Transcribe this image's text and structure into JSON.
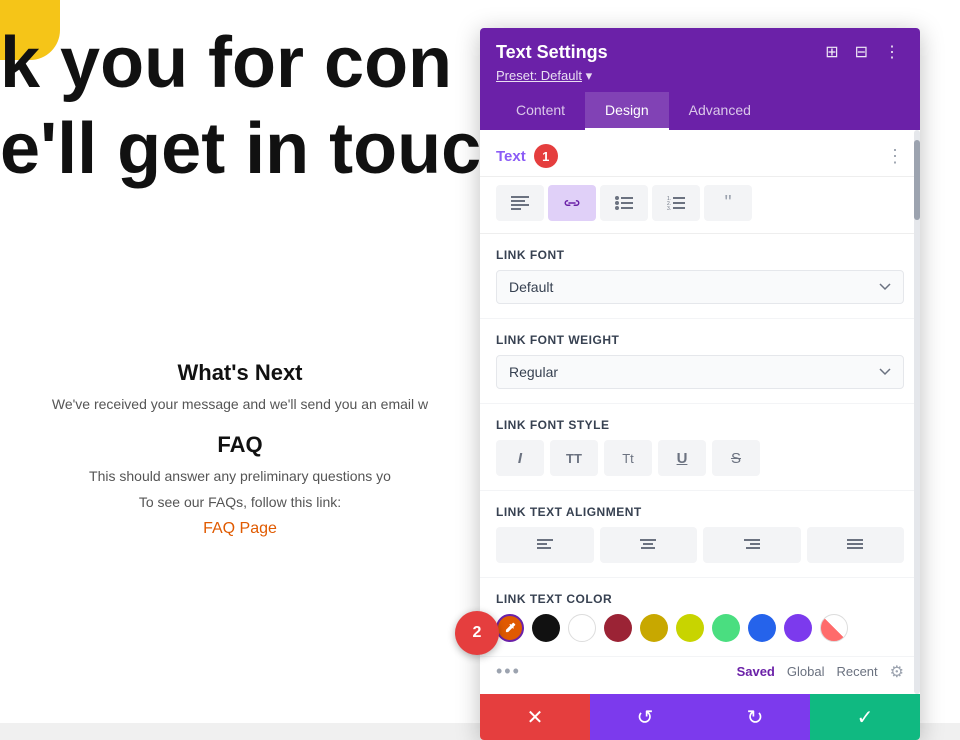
{
  "page": {
    "bg_text_line1": "k you for con",
    "bg_text_line2": "e'll get in touc",
    "whats_next_title": "What's Next",
    "whats_next_body": "We've received your message and we'll send you an email w",
    "faq_title": "FAQ",
    "faq_body": "This should answer any preliminary questions yo",
    "faq_link_label": "To see our FAQs, follow this link:",
    "faq_page_link": "FAQ Page"
  },
  "panel": {
    "title": "Text Settings",
    "preset_label": "Preset: Default",
    "tabs": [
      {
        "id": "content",
        "label": "Content",
        "active": false
      },
      {
        "id": "design",
        "label": "Design",
        "active": true
      },
      {
        "id": "advanced",
        "label": "Advanced",
        "active": false
      }
    ],
    "section_title": "Text",
    "badge_number": "1",
    "toolbar_icons": [
      {
        "id": "align-left",
        "symbol": "≡",
        "active": false
      },
      {
        "id": "link",
        "symbol": "🔗",
        "active": true
      },
      {
        "id": "list-ul",
        "symbol": "☰",
        "active": false
      },
      {
        "id": "list-ol",
        "symbol": "≡",
        "active": false
      },
      {
        "id": "quote",
        "symbol": "❝",
        "active": false
      }
    ],
    "link_font_label": "Link Font",
    "link_font_value": "Default",
    "link_font_weight_label": "Link Font Weight",
    "link_font_weight_value": "Regular",
    "link_font_style_label": "Link Font Style",
    "link_text_alignment_label": "Link Text Alignment",
    "link_text_color_label": "Link Text Color",
    "color_swatches": [
      {
        "id": "picker",
        "type": "picker",
        "color": "#e05a00"
      },
      {
        "id": "black",
        "color": "#111111"
      },
      {
        "id": "white",
        "color": "#ffffff"
      },
      {
        "id": "red",
        "color": "#9b2335"
      },
      {
        "id": "yellow",
        "color": "#c8a800"
      },
      {
        "id": "lime",
        "color": "#c8d400"
      },
      {
        "id": "green",
        "color": "#4ade80"
      },
      {
        "id": "blue",
        "color": "#2563eb"
      },
      {
        "id": "purple",
        "color": "#7c3aed"
      },
      {
        "id": "transparent",
        "type": "transparent"
      }
    ],
    "color_tab_saved": "Saved",
    "color_tab_global": "Global",
    "color_tab_recent": "Recent",
    "footer_buttons": [
      {
        "id": "cancel",
        "symbol": "✕",
        "color": "#e53e3e"
      },
      {
        "id": "undo",
        "symbol": "↺",
        "color": "#7c3aed"
      },
      {
        "id": "redo",
        "symbol": "↻",
        "color": "#7c3aed"
      },
      {
        "id": "save",
        "symbol": "✓",
        "color": "#10b981"
      }
    ]
  },
  "fab_badge_1": "1",
  "fab_badge_2": "2"
}
